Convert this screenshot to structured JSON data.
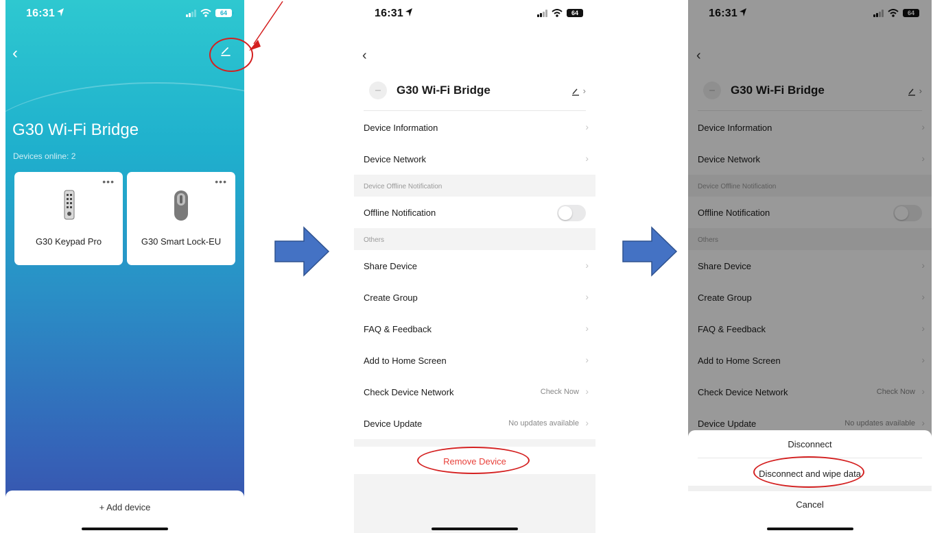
{
  "status": {
    "time": "16:31",
    "battery": "64"
  },
  "screen1": {
    "title": "G30 Wi-Fi Bridge",
    "devices_online": "Devices online: 2",
    "cards": [
      {
        "name": "G30 Keypad Pro",
        "menu": "•••"
      },
      {
        "name": "G30 Smart Lock-EU",
        "menu": "•••"
      }
    ],
    "add_device": "+ Add device"
  },
  "screen2": {
    "device_name": "G30 Wi-Fi Bridge",
    "rows": {
      "device_information": "Device Information",
      "device_network": "Device Network",
      "offline_section": "Device Offline Notification",
      "offline_notification": "Offline Notification",
      "others_section": "Others",
      "share_device": "Share Device",
      "create_group": "Create Group",
      "faq": "FAQ & Feedback",
      "add_home": "Add to Home Screen",
      "check_network": "Check Device Network",
      "check_now": "Check Now",
      "device_update": "Device Update",
      "no_updates": "No updates available",
      "remove_device": "Remove Device"
    }
  },
  "screen3": {
    "sheet": {
      "disconnect": "Disconnect",
      "disconnect_wipe": "Disconnect and wipe data",
      "cancel": "Cancel"
    }
  },
  "colors": {
    "annotation_red": "#d42020",
    "arrow_blue": "#4472c4",
    "danger_text": "#e8403a"
  },
  "icons": [
    "back-chevron-icon",
    "edit-pencil-icon",
    "signal-icon",
    "wifi-icon",
    "battery-icon",
    "location-arrow-icon",
    "more-dots-icon",
    "chevron-right-icon",
    "plus-icon"
  ]
}
